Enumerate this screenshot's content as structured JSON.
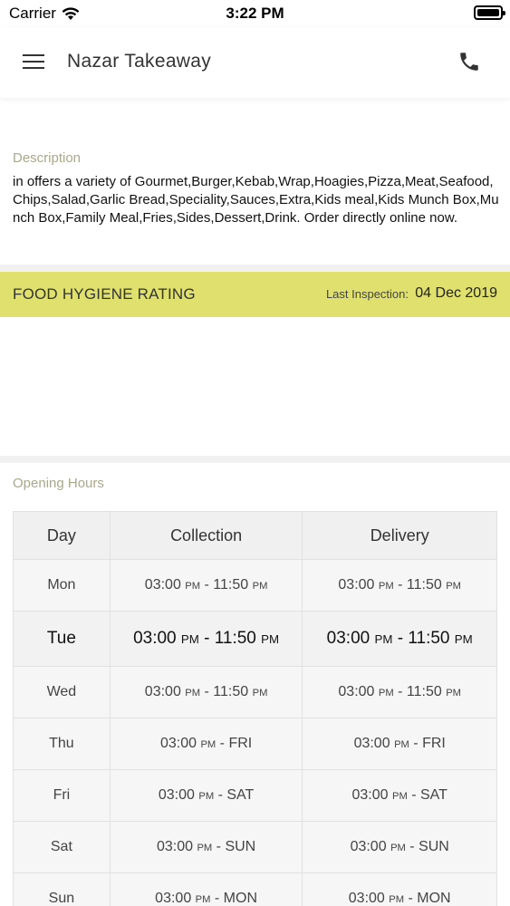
{
  "status_bar": {
    "carrier": "Carrier",
    "time": "3:22 PM"
  },
  "header": {
    "title": "Nazar Takeaway",
    "menu_icon": "hamburger-menu-icon",
    "phone_icon": "phone-icon"
  },
  "description": {
    "label": "Description",
    "text": "in  offers a variety of Gourmet,Burger,Kebab,Wrap,Hoagies,Pizza,Meat,Seafood,Chips,Salad,Garlic Bread,Speciality,Sauces,Extra,Kids meal,Kids Munch Box,Munch Box,Family Meal,Fries,Sides,Dessert,Drink. Order directly online now."
  },
  "hygiene": {
    "title": "FOOD HYGIENE RATING",
    "inspection_label": "Last Inspection:",
    "inspection_date": "04 Dec 2019",
    "bar_color": "#dfe06e"
  },
  "opening_hours": {
    "label": "Opening Hours",
    "headers": [
      "Day",
      "Collection",
      "Delivery"
    ],
    "rows": [
      {
        "day": "Mon",
        "collection_start": "03:00",
        "collection_start_ampm": "PM",
        "collection_end": "11:50",
        "collection_end_ampm": "PM",
        "delivery_start": "03:00",
        "delivery_start_ampm": "PM",
        "delivery_end": "11:50",
        "delivery_end_ampm": "PM",
        "today": false
      },
      {
        "day": "Tue",
        "collection_start": "03:00",
        "collection_start_ampm": "PM",
        "collection_end": "11:50",
        "collection_end_ampm": "PM",
        "delivery_start": "03:00",
        "delivery_start_ampm": "PM",
        "delivery_end": "11:50",
        "delivery_end_ampm": "PM",
        "today": true
      },
      {
        "day": "Wed",
        "collection_start": "03:00",
        "collection_start_ampm": "PM",
        "collection_end": "11:50",
        "collection_end_ampm": "PM",
        "delivery_start": "03:00",
        "delivery_start_ampm": "PM",
        "delivery_end": "11:50",
        "delivery_end_ampm": "PM",
        "today": false
      },
      {
        "day": "Thu",
        "collection_start": "03:00",
        "collection_start_ampm": "PM",
        "collection_end": "FRI",
        "collection_end_ampm": "",
        "delivery_start": "03:00",
        "delivery_start_ampm": "PM",
        "delivery_end": "FRI",
        "delivery_end_ampm": "",
        "today": false
      },
      {
        "day": "Fri",
        "collection_start": "03:00",
        "collection_start_ampm": "PM",
        "collection_end": "SAT",
        "collection_end_ampm": "",
        "delivery_start": "03:00",
        "delivery_start_ampm": "PM",
        "delivery_end": "SAT",
        "delivery_end_ampm": "",
        "today": false
      },
      {
        "day": "Sat",
        "collection_start": "03:00",
        "collection_start_ampm": "PM",
        "collection_end": "SUN",
        "collection_end_ampm": "",
        "delivery_start": "03:00",
        "delivery_start_ampm": "PM",
        "delivery_end": "SUN",
        "delivery_end_ampm": "",
        "today": false
      },
      {
        "day": "Sun",
        "collection_start": "03:00",
        "collection_start_ampm": "PM",
        "collection_end": "MON",
        "collection_end_ampm": "",
        "delivery_start": "03:00",
        "delivery_start_ampm": "PM",
        "delivery_end": "MON",
        "delivery_end_ampm": "",
        "today": false
      }
    ]
  }
}
